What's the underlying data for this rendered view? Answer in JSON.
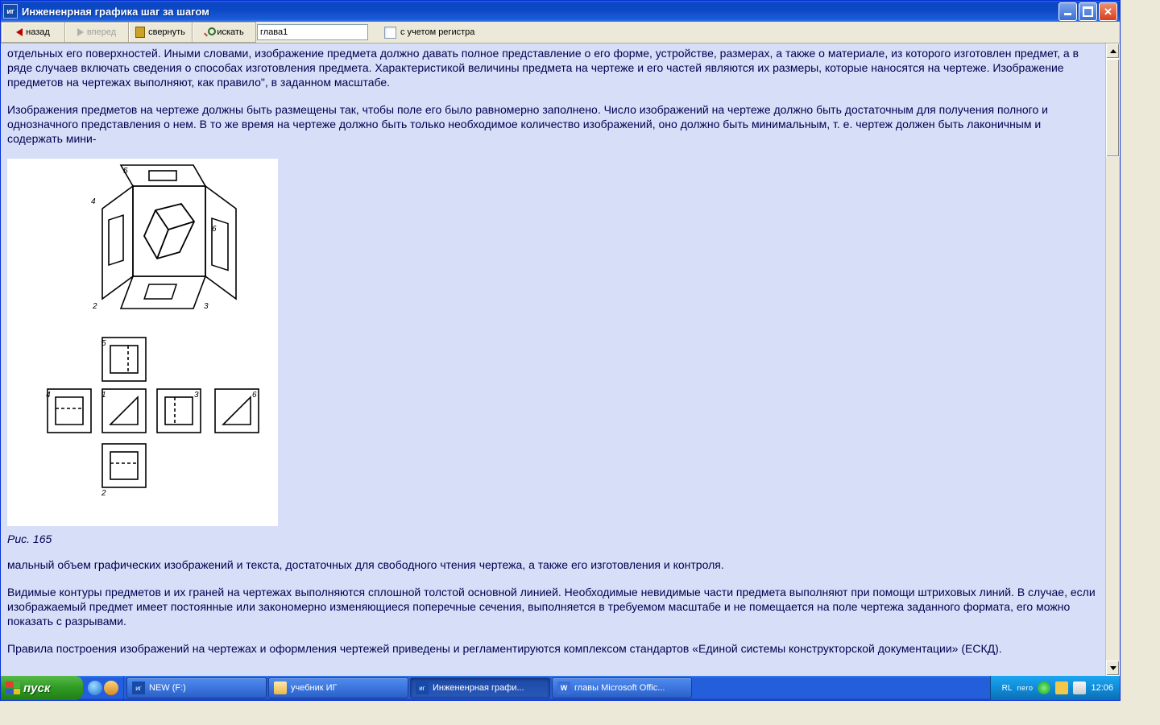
{
  "window": {
    "title": "Инжененрная графика шаг за шагом",
    "app_icon_label": "иг"
  },
  "toolbar": {
    "back": "назад",
    "forward": "вперед",
    "collapse": "свернуть",
    "search": "искать",
    "search_value": "глава1",
    "case_label": "с учетом регистра"
  },
  "content": {
    "p1": "отдельных его поверхностей. Иными словами, изображение предмета должно давать полное представление о его форме, устройстве, размерах, а также о материале, из которого изготовлен предмет, а в ряде случаев включать сведения о способах изготовления предмета. Характеристикой величины предмета на чертеже и его частей являются их размеры, которые наносятся на чертеже. Изображение предметов на чертежах выполняют, как правило\", в заданном масштабе.",
    "p2": "Изображения предметов на чертеже должны быть размещены так, чтобы поле его было равномерно заполнено. Число изображений на чертеже должно быть достаточным для получения полного и однозначного представления о нем. В то же время на чертеже должно быть только необходимое количество изображений, оно должно быть минимальным, т. е. чертеж должен быть лаконичным и содержать мини-",
    "fig_caption": "Рис. 165",
    "p3": "мальный объем графических изображений и текста, достаточных для свободного чтения чертежа, а также его изготовления и контроля.",
    "p4": "Видимые контуры предметов и их граней на чертежах выполняются сплошной толстой основной линией. Необходимые невидимые части предмета выполняют при помощи штриховых линий. В случае, если изображаемый предмет имеет постоянные или закономерно изменяющиеся поперечные сечения, выполняется в требуемом масштабе и не помещается на поле чертежа заданного формата, его можно показать с разрывами.",
    "p5": "Правила построения изображений на чертежах и оформления чертежей приведены и регламентируются комплексом стандартов «Единой системы конструкторской документации» (ЕСКД)."
  },
  "taskbar": {
    "start": "пуск",
    "tasks": [
      {
        "label": "NEW (F:)",
        "icon": "ig"
      },
      {
        "label": "учебник ИГ",
        "icon": "folder"
      },
      {
        "label": "Инжененрная графи...",
        "icon": "ig",
        "active": true
      },
      {
        "label": "главы Microsoft Offic...",
        "icon": "word"
      }
    ],
    "lang": "RL",
    "nero": "nero",
    "clock": "12:06"
  }
}
